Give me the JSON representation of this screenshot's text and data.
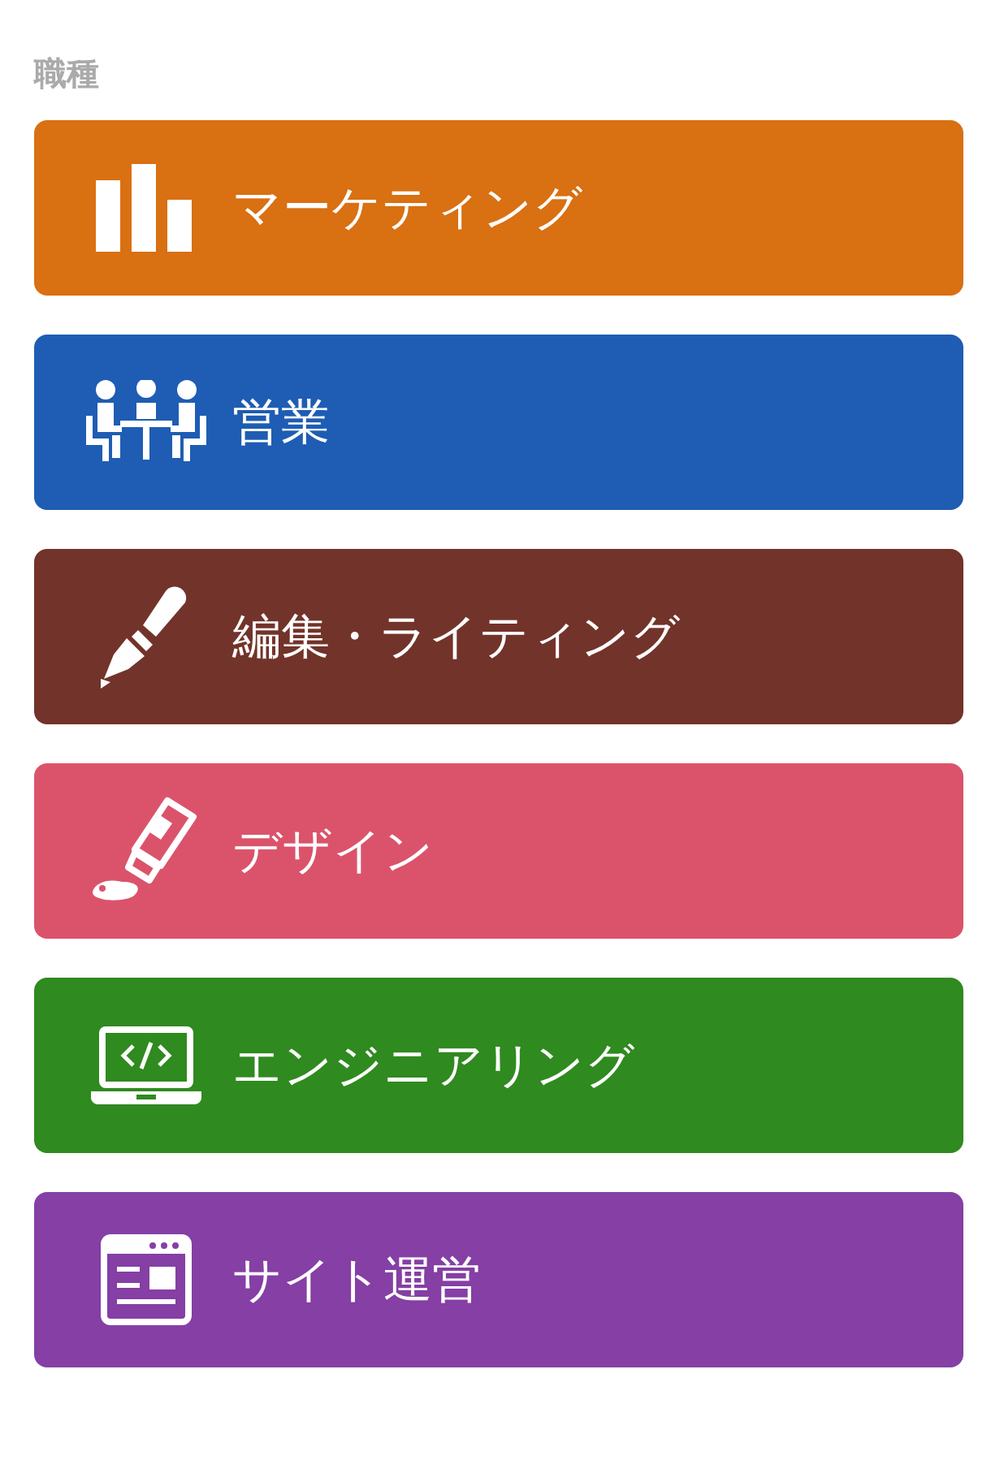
{
  "heading": "職種",
  "categories": [
    {
      "label": "マーケティング",
      "kind": "chart",
      "color": "#d97012"
    },
    {
      "label": "営業",
      "kind": "meeting",
      "color": "#1e5db3"
    },
    {
      "label": "編集・ライティング",
      "kind": "pen",
      "color": "#72332a"
    },
    {
      "label": "デザイン",
      "kind": "paint",
      "color": "#db536b"
    },
    {
      "label": "エンジニアリング",
      "kind": "laptop",
      "color": "#2f8a1f"
    },
    {
      "label": "サイト運営",
      "kind": "browser",
      "color": "#853fa5"
    }
  ]
}
